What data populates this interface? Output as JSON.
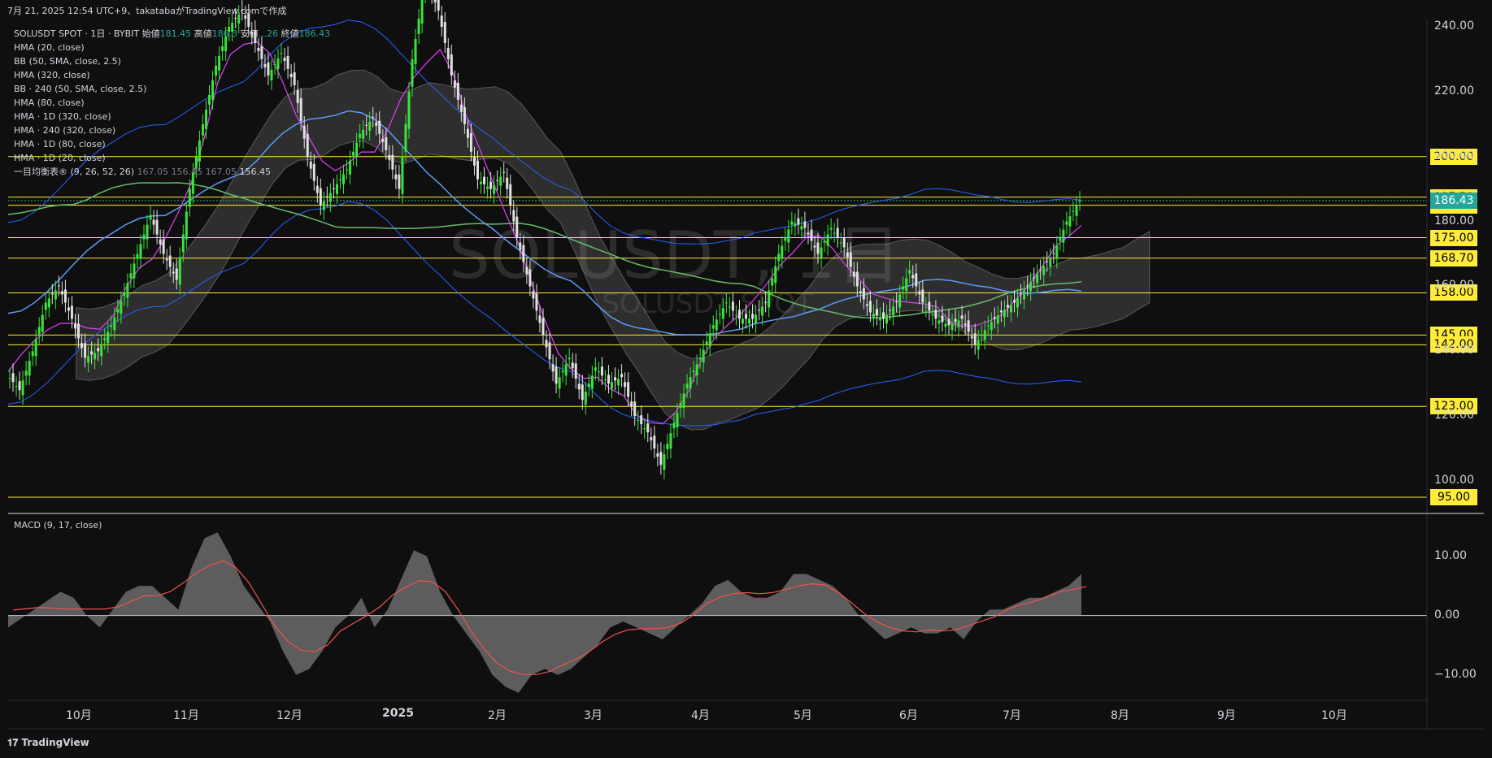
{
  "header": {
    "text": "7月 21, 2025 12:54 UTC+9、takatabaがTradingView.comで作成"
  },
  "legend": {
    "symbol_line_prefix": "SOLUSDT SPOT · 1日 · BYBIT  始値",
    "open": "181.45",
    "high_label": " 高値",
    "high": "186.3",
    "low_label": " 安値",
    "low": "...26",
    "close_label": " 終値",
    "close": "186.43",
    "items": [
      "HMA (20, close)",
      "BB (50, SMA, close, 2.5)",
      "HMA (320, close)",
      "BB · 240 (50, SMA, close, 2.5)",
      "HMA (80, close)",
      "HMA · 1D (320, close)",
      "HMA · 240 (320, close)",
      "HMA · 1D (80, close)",
      "HMA · 1D (20, close)"
    ],
    "ichimoku_label": "一目均衡表® (9, 26, 52, 26)",
    "ichimoku_values": [
      "167.05",
      "156.45",
      "167.05",
      "156.45"
    ]
  },
  "watermark": {
    "main": "SOLUSDT, 1日",
    "sub": "SOLUSDT SPOT"
  },
  "macd_legend": "MACD (9, 17, close)",
  "footer": {
    "brand": "TradingView"
  },
  "chart_data": {
    "type": "candlestick",
    "symbol": "SOLUSDT",
    "price_axis": {
      "ticks": [
        "240.00",
        "220.00",
        "200.00",
        "180.00",
        "160.00",
        "140.00",
        "120.00",
        "100.00"
      ],
      "range": [
        90,
        242
      ]
    },
    "current_price": "186.43",
    "horizontal_levels": [
      "200.00",
      "187.50",
      "185.00",
      "175.00",
      "168.70",
      "158.00",
      "145.00",
      "142.00",
      "123.00",
      "95.00"
    ],
    "months": [
      "10月",
      "11月",
      "12月",
      "2025",
      "2月",
      "3月",
      "4月",
      "5月",
      "6月",
      "7月",
      "8月",
      "9月",
      "10月"
    ],
    "price_path": [
      [
        0,
        133
      ],
      [
        5,
        128
      ],
      [
        10,
        140
      ],
      [
        15,
        155
      ],
      [
        20,
        160
      ],
      [
        25,
        150
      ],
      [
        30,
        138
      ],
      [
        35,
        140
      ],
      [
        40,
        148
      ],
      [
        45,
        158
      ],
      [
        50,
        170
      ],
      [
        55,
        182
      ],
      [
        60,
        170
      ],
      [
        65,
        162
      ],
      [
        70,
        190
      ],
      [
        75,
        210
      ],
      [
        80,
        228
      ],
      [
        85,
        240
      ],
      [
        90,
        245
      ],
      [
        95,
        235
      ],
      [
        100,
        225
      ],
      [
        105,
        232
      ],
      [
        110,
        222
      ],
      [
        115,
        200
      ],
      [
        120,
        185
      ],
      [
        125,
        190
      ],
      [
        130,
        196
      ],
      [
        135,
        207
      ],
      [
        140,
        212
      ],
      [
        145,
        202
      ],
      [
        150,
        190
      ],
      [
        155,
        230
      ],
      [
        160,
        255
      ],
      [
        165,
        245
      ],
      [
        170,
        225
      ],
      [
        175,
        210
      ],
      [
        180,
        193
      ],
      [
        185,
        190
      ],
      [
        190,
        195
      ],
      [
        195,
        175
      ],
      [
        200,
        160
      ],
      [
        205,
        145
      ],
      [
        210,
        130
      ],
      [
        215,
        138
      ],
      [
        220,
        125
      ],
      [
        225,
        135
      ],
      [
        230,
        130
      ],
      [
        235,
        132
      ],
      [
        240,
        120
      ],
      [
        245,
        115
      ],
      [
        250,
        105
      ],
      [
        255,
        118
      ],
      [
        260,
        130
      ],
      [
        265,
        138
      ],
      [
        270,
        148
      ],
      [
        275,
        155
      ],
      [
        280,
        150
      ],
      [
        285,
        150
      ],
      [
        290,
        155
      ],
      [
        295,
        170
      ],
      [
        300,
        180
      ],
      [
        305,
        178
      ],
      [
        310,
        170
      ],
      [
        315,
        178
      ],
      [
        320,
        172
      ],
      [
        325,
        160
      ],
      [
        330,
        152
      ],
      [
        335,
        150
      ],
      [
        340,
        155
      ],
      [
        345,
        165
      ],
      [
        350,
        155
      ],
      [
        355,
        150
      ],
      [
        360,
        148
      ],
      [
        365,
        150
      ],
      [
        370,
        142
      ],
      [
        375,
        148
      ],
      [
        380,
        152
      ],
      [
        385,
        155
      ],
      [
        390,
        160
      ],
      [
        395,
        165
      ],
      [
        400,
        170
      ],
      [
        405,
        180
      ],
      [
        410,
        186.4
      ]
    ],
    "macd": {
      "y_ticks": [
        "10.00",
        "0.00",
        "−10.00"
      ],
      "range": [
        -14,
        15
      ],
      "histogram": [
        [
          0,
          -2
        ],
        [
          10,
          1
        ],
        [
          20,
          4
        ],
        [
          25,
          3
        ],
        [
          30,
          0
        ],
        [
          35,
          -2
        ],
        [
          40,
          1
        ],
        [
          45,
          4
        ],
        [
          50,
          5
        ],
        [
          55,
          5
        ],
        [
          60,
          3
        ],
        [
          65,
          1
        ],
        [
          70,
          8
        ],
        [
          75,
          13
        ],
        [
          80,
          14
        ],
        [
          85,
          10
        ],
        [
          90,
          5
        ],
        [
          95,
          2
        ],
        [
          100,
          -1
        ],
        [
          105,
          -6
        ],
        [
          110,
          -10
        ],
        [
          115,
          -9
        ],
        [
          120,
          -6
        ],
        [
          125,
          -2
        ],
        [
          130,
          0
        ],
        [
          135,
          3
        ],
        [
          140,
          -2
        ],
        [
          145,
          1
        ],
        [
          150,
          6
        ],
        [
          155,
          11
        ],
        [
          160,
          10
        ],
        [
          165,
          4
        ],
        [
          170,
          0
        ],
        [
          175,
          -3
        ],
        [
          180,
          -6
        ],
        [
          185,
          -10
        ],
        [
          190,
          -12
        ],
        [
          195,
          -13
        ],
        [
          200,
          -10
        ],
        [
          205,
          -9
        ],
        [
          210,
          -10
        ],
        [
          215,
          -9
        ],
        [
          220,
          -7
        ],
        [
          225,
          -5
        ],
        [
          230,
          -2
        ],
        [
          235,
          -1
        ],
        [
          240,
          -2
        ],
        [
          245,
          -3
        ],
        [
          250,
          -4
        ],
        [
          255,
          -2
        ],
        [
          260,
          0
        ],
        [
          265,
          2
        ],
        [
          270,
          5
        ],
        [
          275,
          6
        ],
        [
          280,
          4
        ],
        [
          285,
          3
        ],
        [
          290,
          3
        ],
        [
          295,
          4
        ],
        [
          300,
          7
        ],
        [
          305,
          7
        ],
        [
          310,
          6
        ],
        [
          315,
          5
        ],
        [
          320,
          3
        ],
        [
          325,
          0
        ],
        [
          330,
          -2
        ],
        [
          335,
          -4
        ],
        [
          340,
          -3
        ],
        [
          345,
          -2
        ],
        [
          350,
          -3
        ],
        [
          355,
          -3
        ],
        [
          360,
          -2
        ],
        [
          365,
          -4
        ],
        [
          370,
          -1
        ],
        [
          375,
          1
        ],
        [
          380,
          1
        ],
        [
          385,
          2
        ],
        [
          390,
          3
        ],
        [
          395,
          3
        ],
        [
          400,
          4
        ],
        [
          405,
          5
        ],
        [
          410,
          7
        ]
      ]
    }
  }
}
